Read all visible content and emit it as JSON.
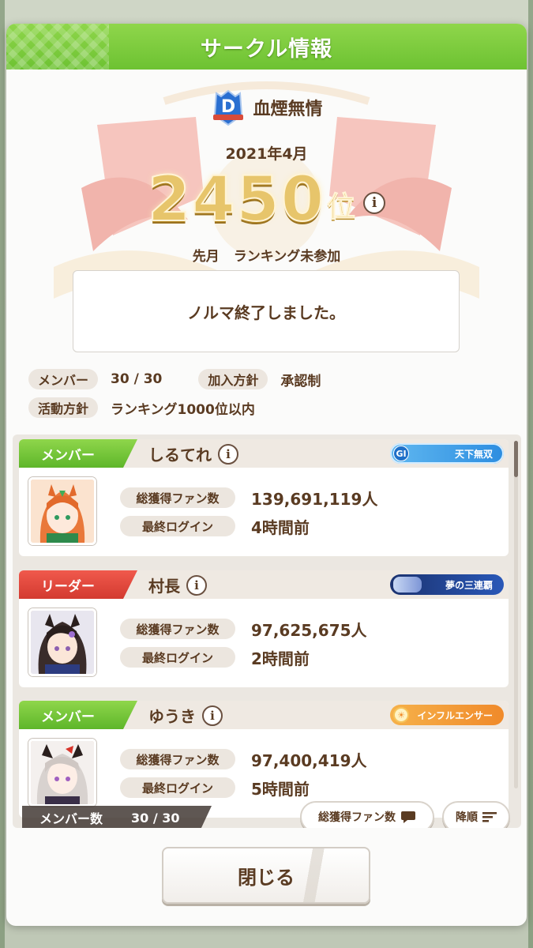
{
  "dialog": {
    "title": "サークル情報"
  },
  "circle": {
    "rank_letter": "D",
    "name": "血煙無情",
    "month": "2021年4月",
    "rank_number": "2450",
    "rank_unit": "位",
    "last_month_label": "先月",
    "last_month_value": "ランキング未参加",
    "quota_message": "ノルマ終了しました。"
  },
  "meta": {
    "members_label": "メンバー",
    "members_value": "30 / 30",
    "join_policy_label": "加入方針",
    "join_policy_value": "承認制",
    "activity_label": "活動方針",
    "activity_value": "ランキング1000位以内"
  },
  "info_glyph": "i",
  "stat_labels": {
    "fans": "総獲得ファン数",
    "login": "最終ログイン"
  },
  "members": [
    {
      "role": "メンバー",
      "name": "しるてれ",
      "badge": "天下無双",
      "badge_icon": "GI",
      "fans": "139,691,119人",
      "login": "4時間前"
    },
    {
      "role": "リーダー",
      "name": "村長",
      "badge": "夢の三連覇",
      "badge_icon": "",
      "fans": "97,625,675人",
      "login": "2時間前"
    },
    {
      "role": "メンバー",
      "name": "ゆうき",
      "badge": "インフルエンサー",
      "badge_icon": "",
      "fans": "97,400,419人",
      "login": "5時間前"
    }
  ],
  "footer": {
    "member_count_label": "メンバー数",
    "member_count_value": "30 / 30",
    "sort_key_button": "総獲得ファン数",
    "sort_order_button": "降順",
    "close_button": "閉じる"
  },
  "colors": {
    "header_green": "#6dc232",
    "leader_red": "#d33a30",
    "text_brown": "#5a3b22",
    "rank_gold": "#e7c56b"
  }
}
